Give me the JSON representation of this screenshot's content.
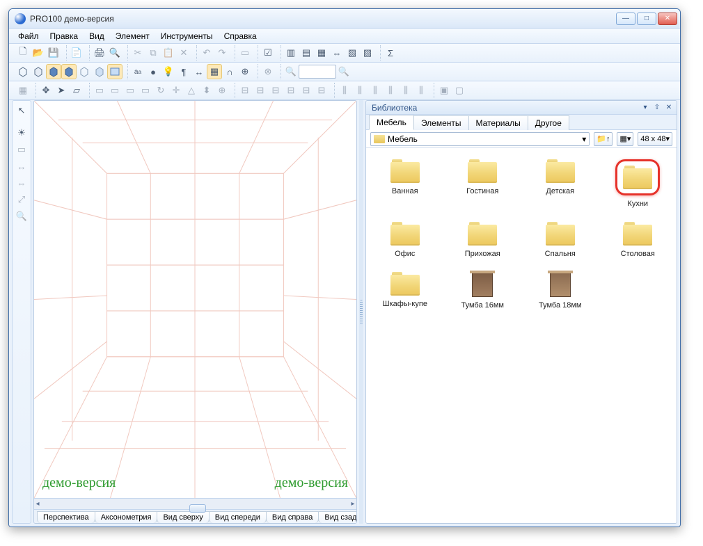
{
  "window": {
    "title": "PRO100 демо-версия"
  },
  "menu": {
    "file": "Файл",
    "edit": "Правка",
    "view": "Вид",
    "element": "Элемент",
    "tools": "Инструменты",
    "help": "Справка"
  },
  "viewport": {
    "watermark_left": "демо-версия",
    "watermark_right": "демо-версия",
    "tabs": {
      "perspective": "Перспектива",
      "axo": "Аксонометрия",
      "top": "Вид сверху",
      "front": "Вид спереди",
      "right": "Вид справа",
      "back": "Вид сзади"
    }
  },
  "library": {
    "title": "Библиотека",
    "tabs": {
      "furniture": "Мебель",
      "elements": "Элементы",
      "materials": "Материалы",
      "other": "Другое"
    },
    "path": "Мебель",
    "size_label": "48 x  48",
    "items": {
      "0": "Ванная",
      "1": "Гостиная",
      "2": "Детская",
      "3": "Кухни",
      "4": "Офис",
      "5": "Прихожая",
      "6": "Спальня",
      "7": "Столовая",
      "8": "Шкафы-купе",
      "9": "Тумба 16мм",
      "10": "Тумба 18мм"
    }
  }
}
